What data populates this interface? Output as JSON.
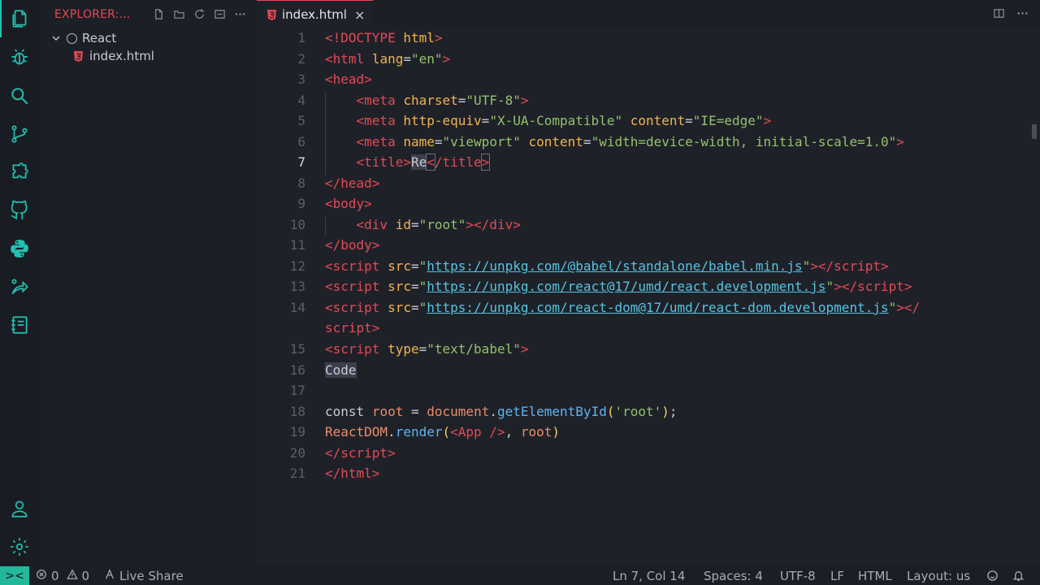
{
  "activity_bar": {
    "icons": [
      "files-icon",
      "debug-icon",
      "search-icon",
      "source-control-icon",
      "extensions-icon",
      "github-icon",
      "python-icon",
      "remote-explorer-icon",
      "notebook-icon",
      "account-icon",
      "settings-gear-icon"
    ]
  },
  "sidebar": {
    "title": "EXPLORER:...",
    "folder": "React",
    "file": "index.html"
  },
  "tab": {
    "label": "index.html",
    "close": "×"
  },
  "editor": {
    "line_numbers": [
      "1",
      "2",
      "3",
      "4",
      "5",
      "6",
      "7",
      "8",
      "9",
      "10",
      "11",
      "12",
      "13",
      "14",
      "",
      "15",
      "16",
      "17",
      "18",
      "19",
      "20",
      "21"
    ],
    "current_line": "7"
  },
  "status": {
    "remote": "><",
    "errors": "0",
    "warnings": "0",
    "live_share": "Live Share",
    "position": "Ln 7, Col 14",
    "spaces": "Spaces: 4",
    "encoding": "UTF-8",
    "eol": "LF",
    "language": "HTML",
    "layout": "Layout: us"
  },
  "colors": {
    "accent": "#e24a55",
    "remote": "#23b89a"
  }
}
